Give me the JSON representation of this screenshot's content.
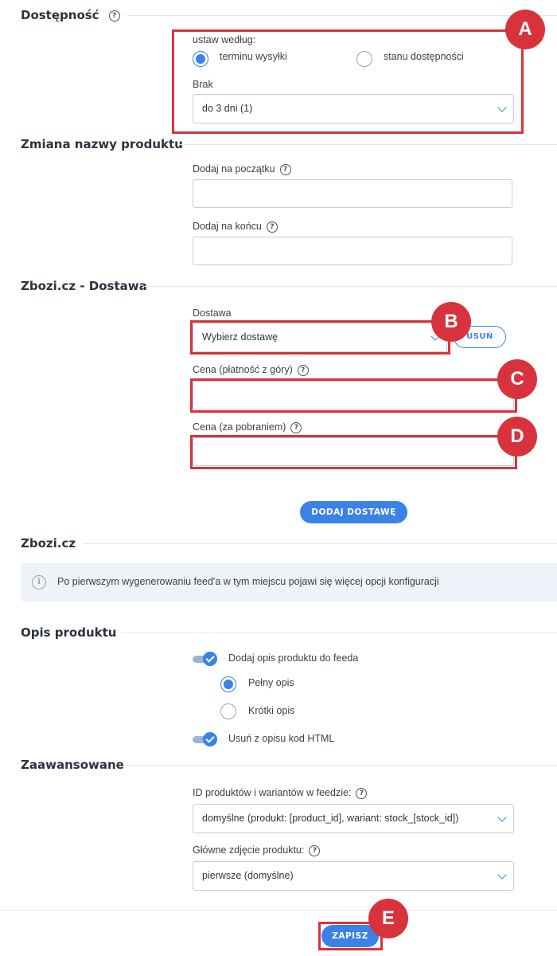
{
  "availability": {
    "title": "Dostępność",
    "set_by_label": "ustaw według:",
    "option_shipping": "terminu wysyłki",
    "option_stock": "stanu dostępności",
    "missing_label": "Brak",
    "missing_value": "do 3 dni (1)"
  },
  "rename": {
    "title": "Zmiana nazwy produktu",
    "prefix_label": "Dodaj na początku",
    "prefix_value": "",
    "suffix_label": "Dodaj na końcu",
    "suffix_value": ""
  },
  "delivery": {
    "title": "Zbozi.cz - Dostawa",
    "delivery_label": "Dostawa",
    "delivery_placeholder": "Wybierz dostawę",
    "remove_button": "USUŃ",
    "price_prepaid_label": "Cena (płatność z góry)",
    "price_cod_label": "Cena (za pobraniem)",
    "add_button": "DODAJ DOSTAWĘ"
  },
  "zbozi": {
    "title": "Zbozi.cz",
    "info_text": "Po pierwszym wygenerowaniu feed'a w tym miejscu pojawi się więcej opcji konfiguracji"
  },
  "description": {
    "title": "Opis produktu",
    "add_description": "Dodaj opis produktu do feeda",
    "full": "Pełny opis",
    "short": "Krótki opis",
    "strip_html": "Usuń z opisu kod HTML"
  },
  "advanced": {
    "title": "Zaawansowane",
    "ids_label": "ID produktów i wariantów w feedzie:",
    "ids_value": "domyślne (produkt: [product_id], wariant: stock_[stock_id])",
    "photo_label": "Główne zdjęcie produktu:",
    "photo_value": "pierwsze (domyślne)"
  },
  "footer": {
    "save_button": "ZAPISZ"
  },
  "markers": {
    "a": "A",
    "b": "B",
    "c": "C",
    "d": "D",
    "e": "E"
  },
  "colors": {
    "accent": "#3b82e6",
    "highlight": "#d8333c"
  },
  "help_glyph": "?",
  "info_glyph": "i"
}
